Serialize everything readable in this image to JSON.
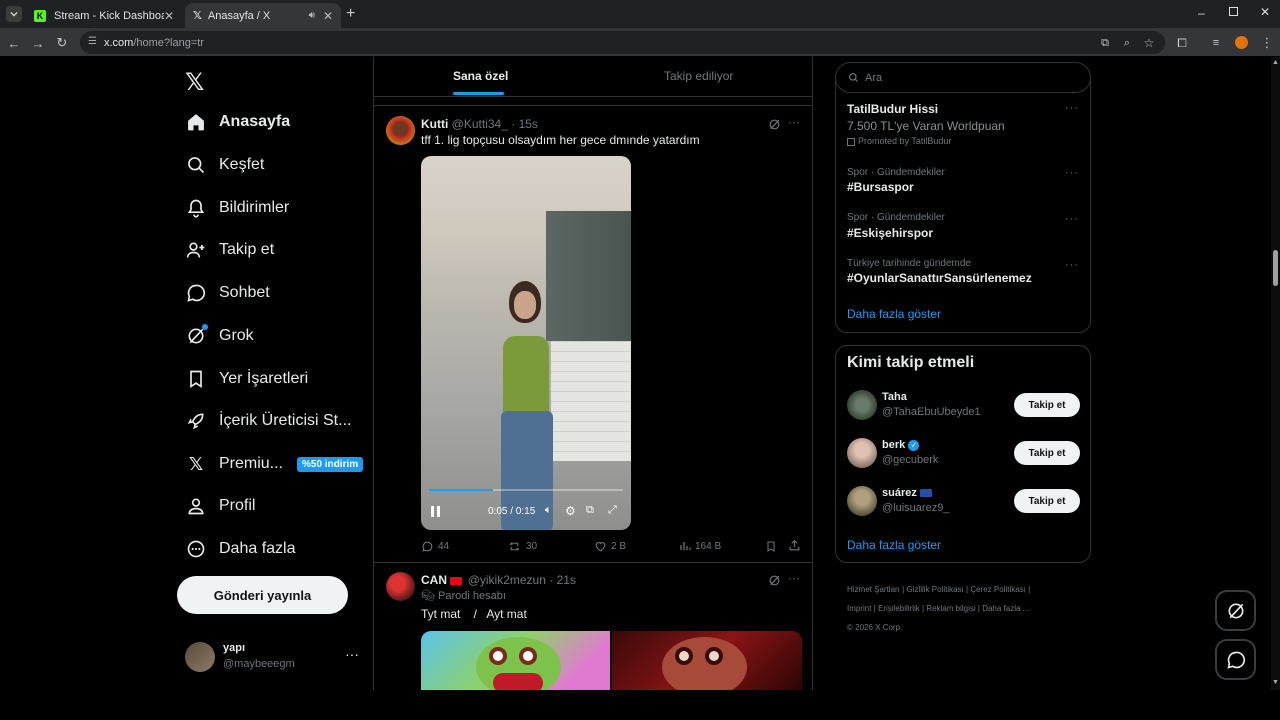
{
  "browser": {
    "tabs": [
      {
        "title": "Stream - Kick Dashboard"
      },
      {
        "title": "Anasayfa / X"
      }
    ],
    "url_host": "x.com",
    "url_path": "/home?lang=tr"
  },
  "nav": {
    "items": [
      {
        "label": "Anasayfa",
        "icon": "home-icon"
      },
      {
        "label": "Keşfet",
        "icon": "search-icon"
      },
      {
        "label": "Bildirimler",
        "icon": "bell-icon"
      },
      {
        "label": "Takip et",
        "icon": "add-user-icon"
      },
      {
        "label": "Sohbet",
        "icon": "chat-icon"
      },
      {
        "label": "Grok",
        "icon": "grok-icon"
      },
      {
        "label": "Yer İşaretleri",
        "icon": "bookmark-icon"
      },
      {
        "label": "İçerik Üreticisi St...",
        "icon": "rocket-icon"
      },
      {
        "label": "Premiu...",
        "icon": "x-logo-icon"
      },
      {
        "label": "Profil",
        "icon": "person-icon"
      },
      {
        "label": "Daha fazla",
        "icon": "more-circle-icon"
      }
    ],
    "premium_badge": "%50 indirim",
    "post_button": "Gönderi yayınla",
    "account": {
      "name": "yapı",
      "handle": "@maybeeegm"
    }
  },
  "feed": {
    "tabs": [
      "Sana özel",
      "Takip ediliyor"
    ],
    "tweets": [
      {
        "name": "Kutti",
        "handle": "@Kutti34_",
        "time": "· 15s",
        "text": "tff 1. lig topçusu olsaydım her gece dmınde yatardım",
        "video_time": "0:05 / 0:15",
        "replies": "44",
        "retweets": "30",
        "likes": "2 B",
        "views": "164 B"
      },
      {
        "name": "CAN",
        "handle": "@yikik2mezun",
        "time": "· 21s",
        "parody": "Parodi hesabı",
        "text": "Tyt mat    /   Ayt mat"
      }
    ]
  },
  "sidebar": {
    "search_placeholder": "Ara",
    "trends": [
      {
        "name": "TatilBudur Hissi",
        "desc": "7.500 TL'ye Varan Worldpuan",
        "promo": "Promoted by TatilBudur"
      },
      {
        "meta": "Spor · Gündemdekiler",
        "name": "#Bursaspor"
      },
      {
        "meta": "Spor · Gündemdekiler",
        "name": "#Eskişehirspor"
      },
      {
        "meta": "Türkiye tarihinde gündemde",
        "name": "#OyunlarSanattırSansürlenemez"
      }
    ],
    "show_more": "Daha fazla göster",
    "who_to_follow_title": "Kimi takip etmeli",
    "follow_label": "Takip et",
    "suggestions": [
      {
        "name": "Taha",
        "handle": "@TahaEbuUbeyde1"
      },
      {
        "name": "berk",
        "handle": "@gecuberk"
      },
      {
        "name": "suárez",
        "handle": "@luisuarez9_"
      }
    ],
    "footer": [
      "Hizmet Şartları",
      "Gizlilik Politikası",
      "Çerez Politikası",
      "Imprint",
      "Erişilebilirlik",
      "Reklam bilgisi",
      "Daha fazla ...",
      "© 2026 X Corp."
    ]
  },
  "colors": {
    "accent": "#1d9bf0",
    "kick_green": "#53fc18",
    "background": "#000000"
  }
}
